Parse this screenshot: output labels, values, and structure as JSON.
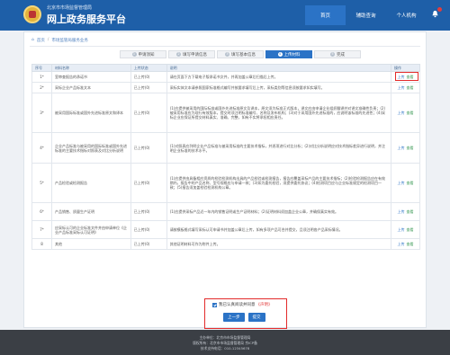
{
  "header": {
    "brand_sub": "北京市市场监督管理局",
    "brand_title": "网上政务服务平台",
    "nav": [
      "首页",
      "辅助查询",
      "个人机构"
    ]
  },
  "breadcrumb": [
    "首页",
    "市场监管局服务业务"
  ],
  "steps": [
    {
      "num": "1",
      "label": "申请须知"
    },
    {
      "num": "2",
      "label": "填写申请信息"
    },
    {
      "num": "3",
      "label": "填写基本信息"
    },
    {
      "num": "4",
      "label": "上传材料"
    },
    {
      "num": "5",
      "label": "完成"
    }
  ],
  "table": {
    "headers": [
      "序号",
      "材料名称",
      "上传状态",
      "说明",
      "操作"
    ],
    "rows": [
      {
        "no": "1*",
        "name": "室审查报告的承诺书",
        "status": "已上传(0)",
        "note": "请在页面下方下载电子版承诺书文件，并再加盖公章后扫描后上传。",
        "ops": [
          "上传",
          "查看"
        ]
      },
      {
        "no": "2*",
        "name": "采标企业产品标准文本",
        "status": "已上传(0)",
        "note": "采标实体文本请参照国家标准格式编写并按要求填写后上传，采标类别等信息须按要求如实填写。",
        "ops": [
          "上传",
          "查看"
        ]
      },
      {
        "no": "3*",
        "name": "被采用国际标准或国外先进标准原文和译本",
        "status": "已上传(0)",
        "note": "(1)应提供被采用的国际标准或国外先进标准原文及译本，原文须为标准正式版本，译文应由申请企业组织翻译并对译文准确性负责；(2)被采用标准应为现行有效版本，提交时须注明标准编号、名称及发布机构；(3)对于采用国外先进标准的，应说明该标准的先进性；(4)采标企业应保证所提交材料真实、准确、完整，如有不实将承担相应责任。",
        "ops": [
          "上传",
          "查看"
        ]
      },
      {
        "no": "4*",
        "name": "企业产品标准与被采用的国际标准或国外先进标准的主要技术指标对照表及对比分析说明",
        "status": "已上传(0)",
        "note": "(1)对照表应列明企业产品标准与被采用标准的主要技术指标，并逐项进行对比分析；(2)对比分析说明应对技术指标差异进行说明，并注明企业标准的技术水平。",
        "ops": [
          "上传",
          "查看"
        ]
      },
      {
        "no": "5*",
        "name": "产品检验或检测报告",
        "status": "已上传(0)",
        "note": "(1)应提供由具备相应资质的检验检测机构出具的产品检验或检测报告，报告应覆盖采标产品的主要技术指标；(2)检验检测报告应在有效期内，报告中的产品名称、型号规格应与申请一致；(3)如为委托检验，须提供委托协议；(4)检测项目应与企业标准规定的检测项目一致；(5)报告须加盖检验检测机构公章。",
        "ops": [
          "上传",
          "查看"
        ]
      },
      {
        "no": "6*",
        "name": "产品销售、质量生产证明",
        "status": "已上传(0)",
        "note": "(1)应提供采标产品近一年内的销售证明或生产证明材料；(2)证明材料须加盖企业公章，并确保真实有效。",
        "ops": [
          "上传",
          "查看"
        ]
      },
      {
        "no": "7*",
        "name": "应采标认可的企业标准文件并由申请单位《企业产品标准采标认可证明》",
        "status": "已上传(0)",
        "note": "请按模板格式填写采标认可申请书并加盖公章后上传，如有多项产品可合并提交，且须注明各产品采标情况。",
        "ops": [
          "上传",
          "查看"
        ]
      },
      {
        "no": "8",
        "name": "其他",
        "status": "已上传(0)",
        "note": "其他证明材料可作为附件上传。",
        "ops": [
          "上传",
          "查看"
        ]
      }
    ]
  },
  "agree": {
    "text": "我已认真阅读并同意",
    "link": "《声明》"
  },
  "buttons": {
    "prev": "上一步",
    "submit": "提交"
  },
  "footer": {
    "line1": "主办单位：北京市市场监督管理局",
    "line2": "版权所有：北京市市场监督管理局 京ICP备",
    "line3": "技术支持电话：010-12345678"
  },
  "colors": {
    "primary": "#1e5fa8",
    "accent": "#2b73c6",
    "highlight": "#e32b2b"
  }
}
